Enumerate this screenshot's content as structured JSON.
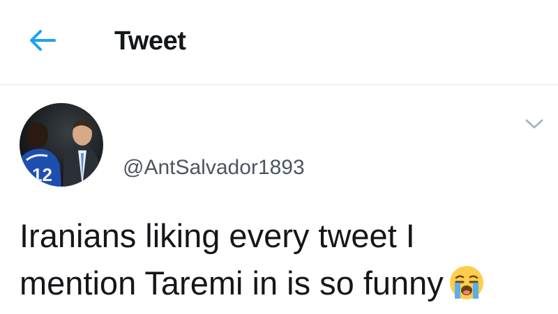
{
  "header": {
    "title": "Tweet",
    "back_icon": "arrow-left-icon"
  },
  "tweet": {
    "handle": "@AntSalvador1893",
    "text": "Iranians liking every tweet I mention Taremi in is so funny",
    "emoji": "loudly-crying-face-icon",
    "menu_icon": "chevron-down-icon"
  },
  "colors": {
    "accent": "#1da1f2",
    "text": "#14171a",
    "secondary": "#4b5560",
    "divider": "#e1e8ed"
  }
}
